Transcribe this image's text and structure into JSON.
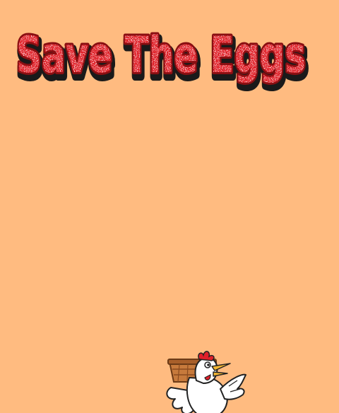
{
  "game": {
    "title": "Save The Eggs"
  },
  "colors": {
    "background": "#ffbb80",
    "title_fill": "#e0202a",
    "title_outline": "#1a1a1a",
    "basket": "#c77a3c",
    "chicken": "#ffffff",
    "comb": "#e0202a",
    "beak": "#f2b632"
  },
  "icons": {
    "player": "chicken-with-basket-icon"
  }
}
